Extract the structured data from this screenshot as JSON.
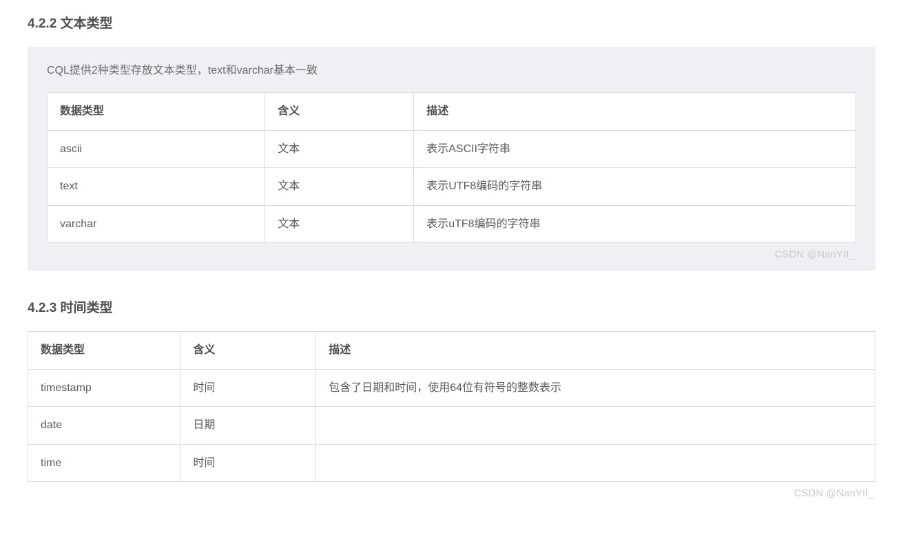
{
  "section1": {
    "heading": "4.2.2 文本类型",
    "intro": "CQL提供2种类型存放文本类型，text和varchar基本一致",
    "table": {
      "headers": [
        "数据类型",
        "含义",
        "描述"
      ],
      "rows": [
        [
          "ascii",
          "文本",
          "表示ASCII字符串"
        ],
        [
          "text",
          "文本",
          "表示UTF8编码的字符串"
        ],
        [
          "varchar",
          "文本",
          "表示uTF8编码的字符串"
        ]
      ]
    },
    "watermark": "CSDN @NanYII_"
  },
  "section2": {
    "heading": "4.2.3 时间类型",
    "table": {
      "headers": [
        "数据类型",
        "含义",
        "描述"
      ],
      "rows": [
        [
          "timestamp",
          "时间",
          "包含了日期和时间，使用64位有符号的整数表示"
        ],
        [
          "date",
          "日期",
          ""
        ],
        [
          "time",
          "时间",
          ""
        ]
      ]
    },
    "watermark": "CSDN @NanYII_"
  }
}
